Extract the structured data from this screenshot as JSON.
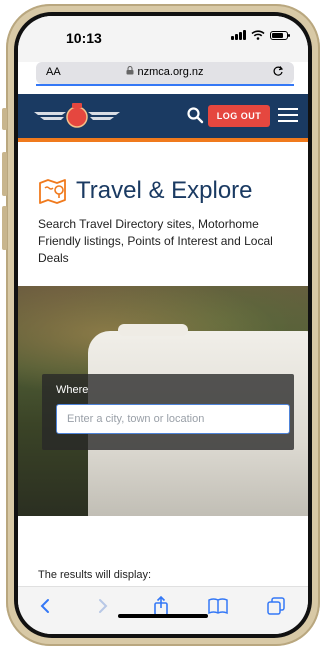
{
  "status_bar": {
    "time": "10:13",
    "battery_level": 0.85
  },
  "browser": {
    "text_size_label": "AA",
    "url": "nzmca.org.nz",
    "icons": [
      "lock-icon",
      "reload-icon"
    ]
  },
  "header": {
    "logout_label": "LOG OUT",
    "icons": [
      "winged-logo-icon",
      "search-icon",
      "hamburger-menu-icon"
    ]
  },
  "hero": {
    "title": "Travel & Explore",
    "description": "Search Travel Directory sites, Motorhome Friendly listings, Points of Interest and Local Deals",
    "icon": "map-icon"
  },
  "search": {
    "label": "Where",
    "placeholder": "Enter a city, town or location",
    "value": ""
  },
  "results_label": "The results will display:",
  "toolbar": {
    "icons": [
      "back-icon",
      "forward-icon",
      "share-icon",
      "bookmarks-icon",
      "tabs-icon"
    ]
  },
  "colors": {
    "header": "#1a3a62",
    "accent": "#f07a1d",
    "logout": "#e5473f",
    "link": "#3478f6"
  }
}
